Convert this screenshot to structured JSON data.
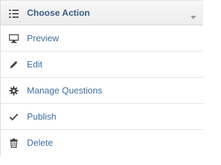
{
  "menu": {
    "header": {
      "title": "Choose Action",
      "icon": "list-icon",
      "expand_icon": "chevron-down-icon"
    },
    "items": [
      {
        "label": "Preview",
        "icon": "monitor-icon"
      },
      {
        "label": "Edit",
        "icon": "pencil-icon"
      },
      {
        "label": "Manage Questions",
        "icon": "gear-icon"
      },
      {
        "label": "Publish",
        "icon": "checkmark-icon"
      },
      {
        "label": "Delete",
        "icon": "trash-icon"
      }
    ]
  },
  "colors": {
    "title": "#3c5f8a",
    "item_text": "#3f6e9e",
    "icon": "#555555",
    "border": "#e2e2e2"
  }
}
